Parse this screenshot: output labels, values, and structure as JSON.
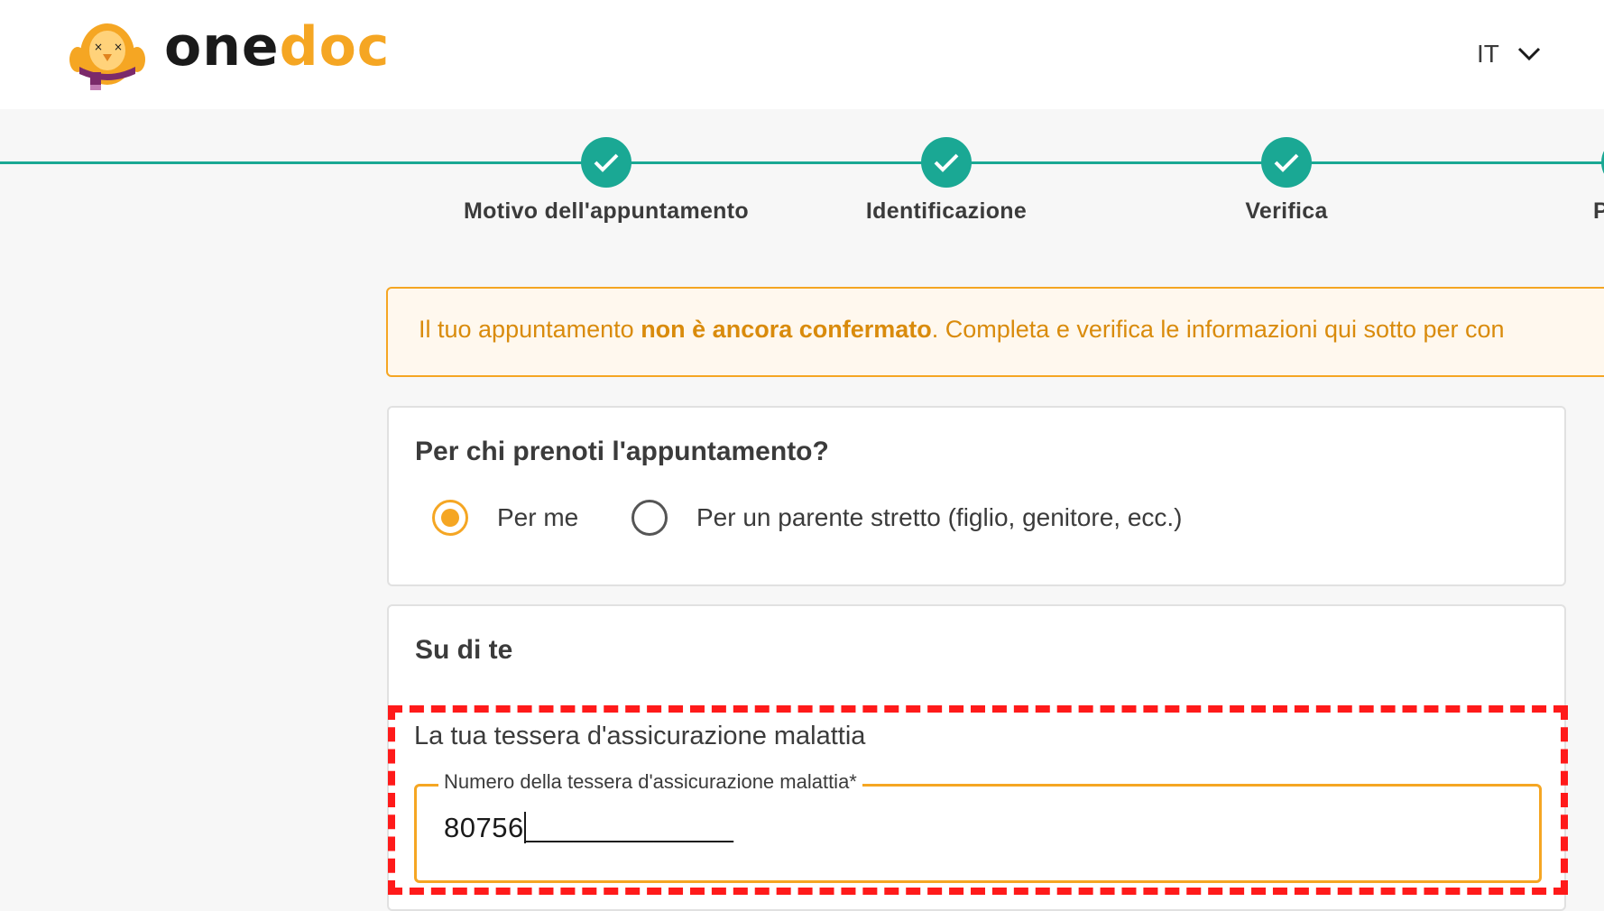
{
  "header": {
    "brand_part1": "one",
    "brand_part2": "doc",
    "language": "IT"
  },
  "steps": [
    {
      "label": "Motivo dell'appuntamento",
      "status": "completed"
    },
    {
      "label": "Identificazione",
      "status": "completed"
    },
    {
      "label": "Verifica",
      "status": "completed"
    },
    {
      "label": "Pa",
      "status": "current"
    }
  ],
  "alert": {
    "prefix": "Il tuo appuntamento ",
    "emphasis": "non è ancora confermato",
    "suffix": ". Completa e verifica le informazioni qui sotto per con"
  },
  "booking_for": {
    "title": "Per chi prenoti l'appuntamento?",
    "options": [
      {
        "label": "Per me",
        "selected": true
      },
      {
        "label": "Per un parente stretto (figlio, genitore, ecc.)",
        "selected": false
      }
    ]
  },
  "about_you": {
    "title": "Su di te",
    "insurance_section_title": "La tua tessera d'assicurazione malattia",
    "insurance_field_label": "Numero della tessera d'assicurazione malattia*",
    "insurance_field_value": "80756",
    "insurance_field_mask": "_____________"
  },
  "colors": {
    "accent": "#f5a623",
    "success": "#1aa894",
    "highlight": "#ff1a1a"
  }
}
